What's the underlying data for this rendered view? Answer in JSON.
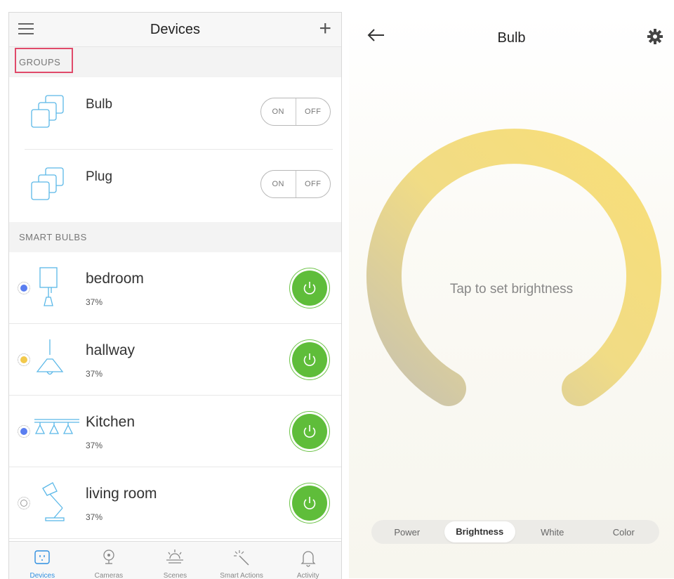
{
  "left": {
    "header": {
      "title": "Devices"
    },
    "groups_label": "GROUPS",
    "groups": [
      {
        "name": "Bulb",
        "on": "ON",
        "off": "OFF"
      },
      {
        "name": "Plug",
        "on": "ON",
        "off": "OFF"
      }
    ],
    "smart_bulbs_label": "SMART BULBS",
    "devices": [
      {
        "name": "bedroom",
        "value": "37%",
        "dot_color": "#5a7ef0"
      },
      {
        "name": "hallway",
        "value": "37%",
        "dot_color": "#f2c94c"
      },
      {
        "name": "Kitchen",
        "value": "37%",
        "dot_color": "#5a7ef0"
      },
      {
        "name": "living room",
        "value": "37%",
        "dot_color": "#ffffff"
      }
    ],
    "tabs": [
      "Devices",
      "Cameras",
      "Scenes",
      "Smart Actions",
      "Activity"
    ],
    "colors": {
      "accent": "#2f8fe0",
      "power": "#5fbd3a",
      "highlight": "#e04a6a"
    }
  },
  "right": {
    "header": {
      "title": "Bulb"
    },
    "message": "Tap to set brightness",
    "modes": [
      "Power",
      "Brightness",
      "White",
      "Color"
    ],
    "selected_mode": "Brightness",
    "colors": {
      "arc_start": "#c9c3ae",
      "arc_end": "#f8de78"
    }
  }
}
